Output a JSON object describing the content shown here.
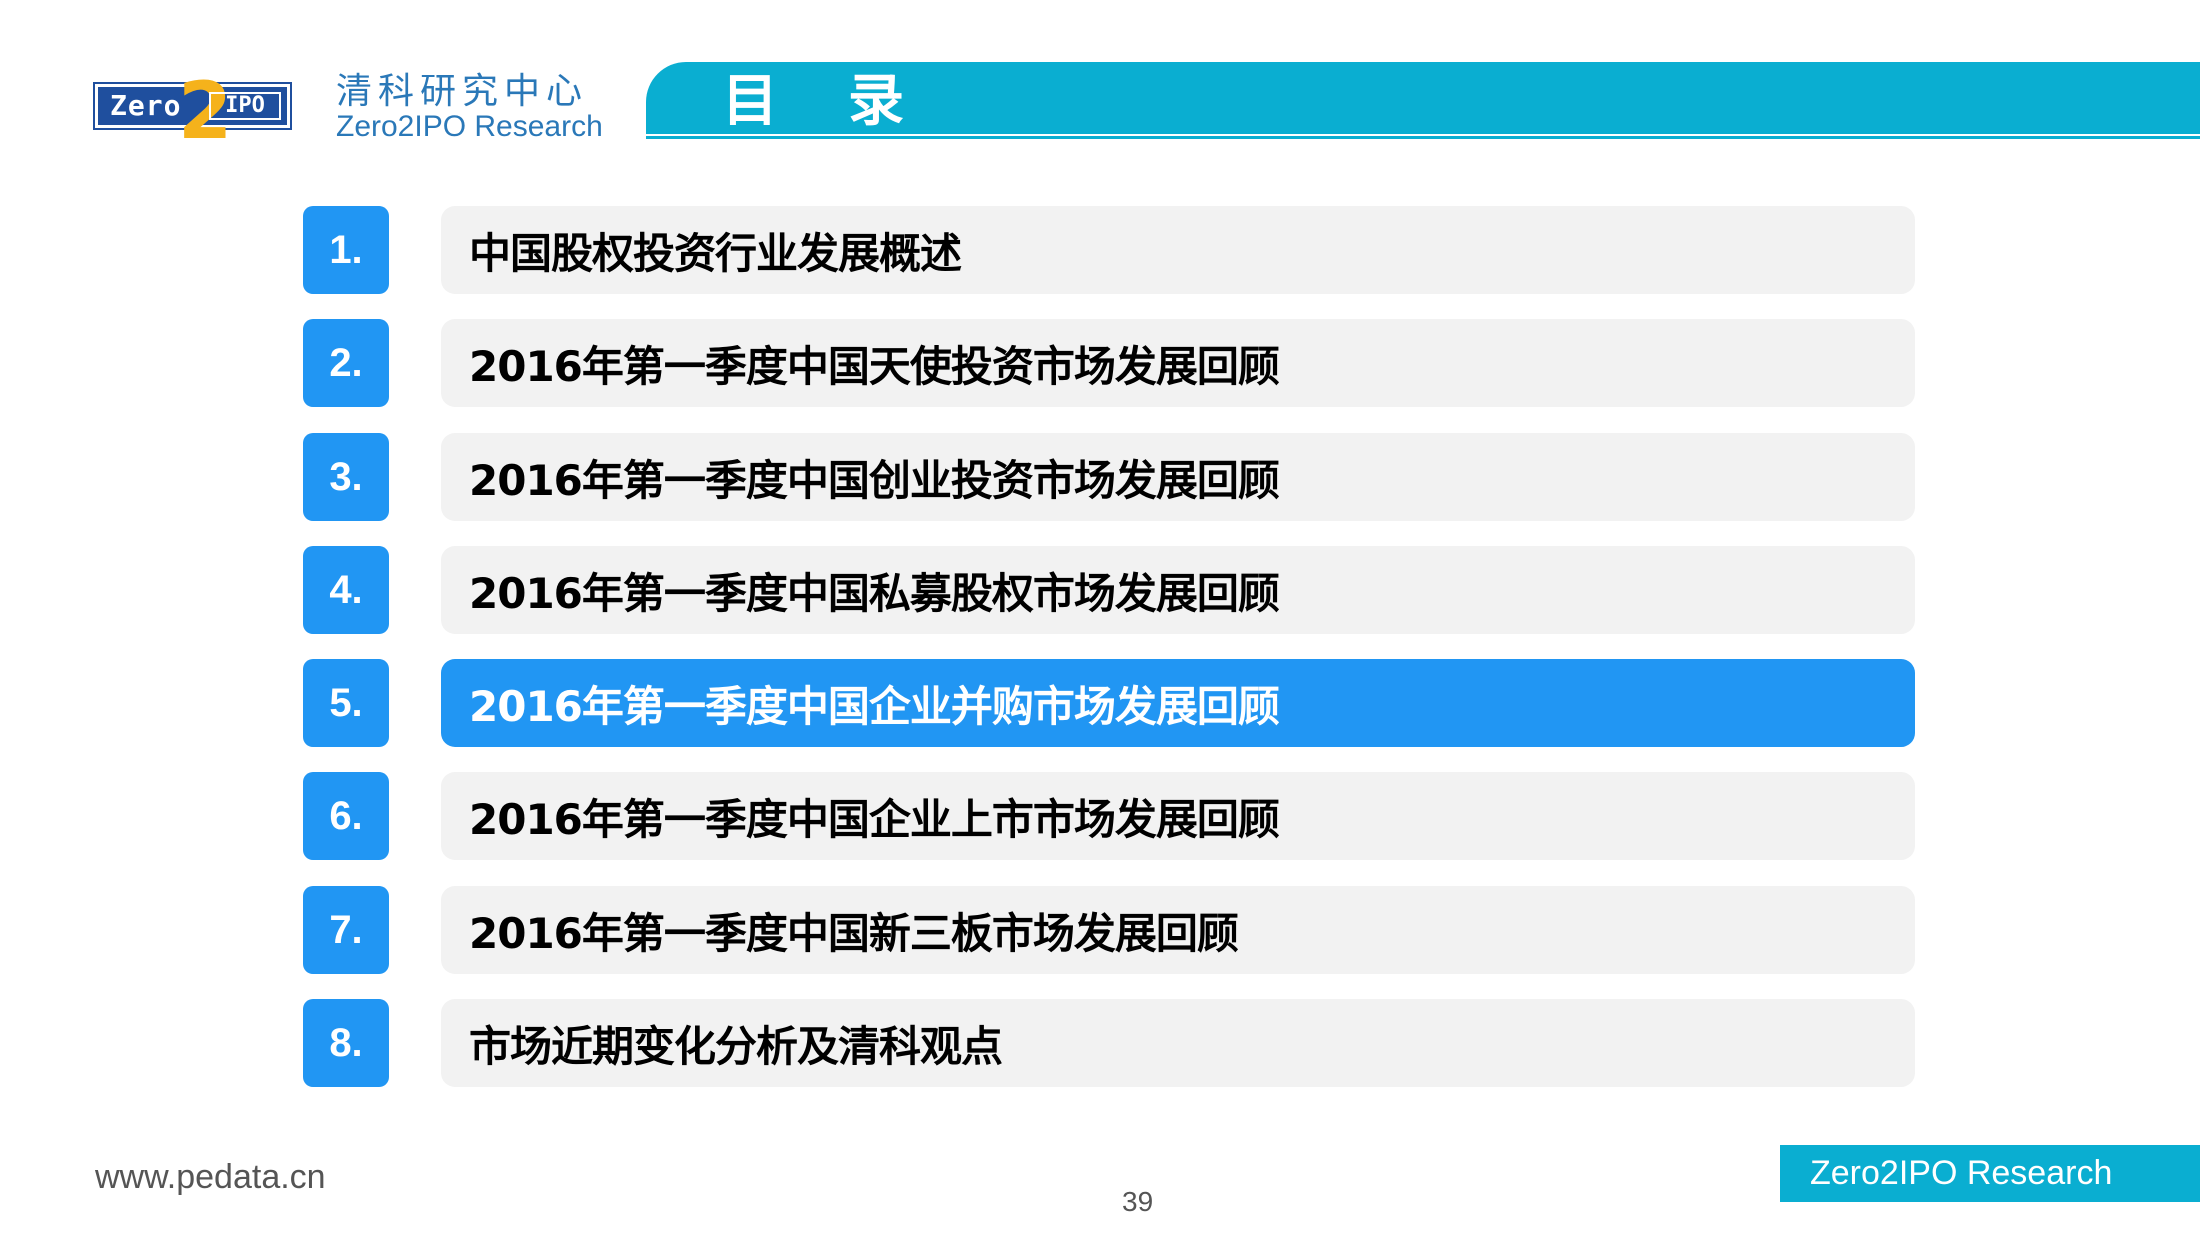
{
  "header": {
    "logo": {
      "zero": "Zero",
      "two": "2",
      "ipo": "IPO"
    },
    "brand_cn": "清科研究中心",
    "brand_en": "Zero2IPO Research",
    "title": "目录"
  },
  "toc": {
    "items": [
      {
        "num": "1.",
        "label": "中国股权投资行业发展概述"
      },
      {
        "num": "2.",
        "label": "2016年第一季度中国天使投资市场发展回顾"
      },
      {
        "num": "3.",
        "label": "2016年第一季度中国创业投资市场发展回顾"
      },
      {
        "num": "4.",
        "label": "2016年第一季度中国私募股权市场发展回顾"
      },
      {
        "num": "5.",
        "label": "2016年第一季度中国企业并购市场发展回顾"
      },
      {
        "num": "6.",
        "label": "2016年第一季度中国企业上市市场发展回顾"
      },
      {
        "num": "7.",
        "label": "2016年第一季度中国新三板市场发展回顾"
      },
      {
        "num": "8.",
        "label": "市场近期变化分析及清科观点"
      }
    ],
    "active_index": 4
  },
  "footer": {
    "url": "www.pedata.cn",
    "page": "39",
    "badge": "Zero2IPO Research"
  },
  "colors": {
    "accent": "#0aaed1",
    "badge_blue": "#2196f3",
    "item_bg": "#f2f2f2",
    "logo_blue": "#1f4f9e",
    "logo_gold": "#f5b21b"
  }
}
